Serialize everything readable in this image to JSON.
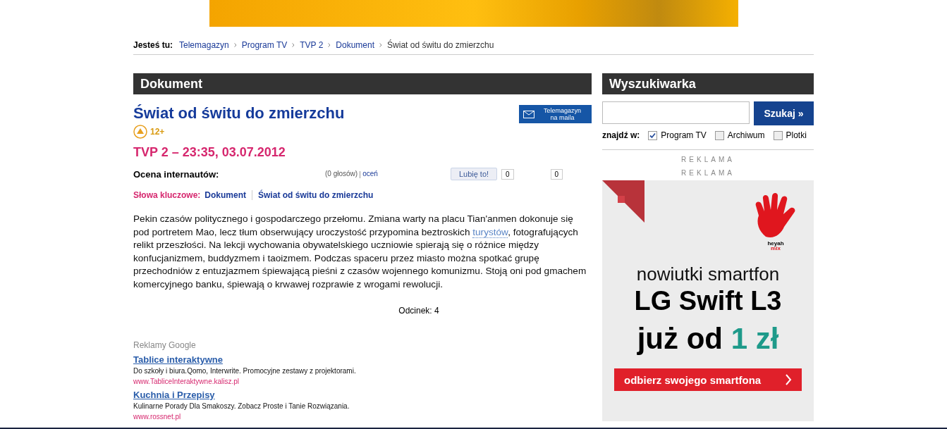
{
  "breadcrumb": {
    "label": "Jesteś tu:",
    "items": [
      {
        "text": "Telemagazyn",
        "kind": "link"
      },
      {
        "text": "Program TV",
        "kind": "link"
      },
      {
        "text": "TVP 2",
        "kind": "link"
      },
      {
        "text": "Dokument",
        "kind": "link"
      },
      {
        "text": "Świat od świtu do zmierzchu",
        "kind": "current"
      }
    ]
  },
  "main": {
    "heading": "Dokument",
    "title": "Świat od świtu do zmierzchu",
    "newsletter_button": [
      "Telemagazyn",
      "na maila"
    ],
    "age_rating": "12+",
    "airing": "TVP 2 – 23:35, 03.07.2012",
    "rating": {
      "label": "Ocena internautów:",
      "votes": "(0 głosów)",
      "rate_link": "oceń"
    },
    "like": {
      "button": "Lubię to!",
      "count": "0",
      "count_2": "0"
    },
    "keywords": {
      "label": "Słowa kluczowe:",
      "items": [
        "Dokument",
        "Świat od świtu do zmierzchu"
      ]
    },
    "description": [
      "Pekin czasów politycznego i gospodarczego przełomu. Zmiana warty na placu Tian'anmen dokonuje się pod portretem Mao, lecz tłum obserwujący uroczystość przypomina beztroskich ",
      "turystów",
      ", fotografujących relikt przeszłości. Na lekcji wychowania obywatelskiego uczniowie spierają się o różnice między konfucjanizmem, buddyzmem i taoizmem. Podczas spaceru przez miasto można spotkać grupę przechodniów z entuzjazmem śpiewającą pieśni z czasów wojennego komunizmu. Stoją oni pod gmachem komercyjnego banku, śpiewają o krwawej rozprawie z wrogami rewolucji."
    ],
    "episode": "Odcinek: 4",
    "google_ads": {
      "label": "Reklamy Google",
      "items": [
        {
          "title": "Tablice interaktywne",
          "text": "Do szkoły i biura.Qomo, Interwrite. Promocyjne zestawy z projektorami.",
          "url": "www.TabliceInteraktywne.kalisz.pl"
        },
        {
          "title": "Kuchnia i Przepisy",
          "text": "Kulinarne Porady Dla Smakoszy. Zobacz Proste i Tanie Rozwiązania.",
          "url": "www.rossnet.pl"
        }
      ]
    }
  },
  "sidebar": {
    "heading": "Wyszukiwarka",
    "search_button": "Szukaj »",
    "filter_label": "znajdź w:",
    "filters": [
      {
        "label": "Program TV",
        "checked": true
      },
      {
        "label": "Archiwum",
        "checked": false
      },
      {
        "label": "Plotki",
        "checked": false
      }
    ],
    "ad_labels": [
      "REKLAMA",
      "REKLAMA"
    ],
    "banner": {
      "logo": [
        "heyah",
        "mix"
      ],
      "line_1": "nowiutki smartfon",
      "line_2": "LG Swift L3",
      "line_3": "już od",
      "price": "1 zł",
      "cta": "odbierz swojego smartfona"
    }
  }
}
